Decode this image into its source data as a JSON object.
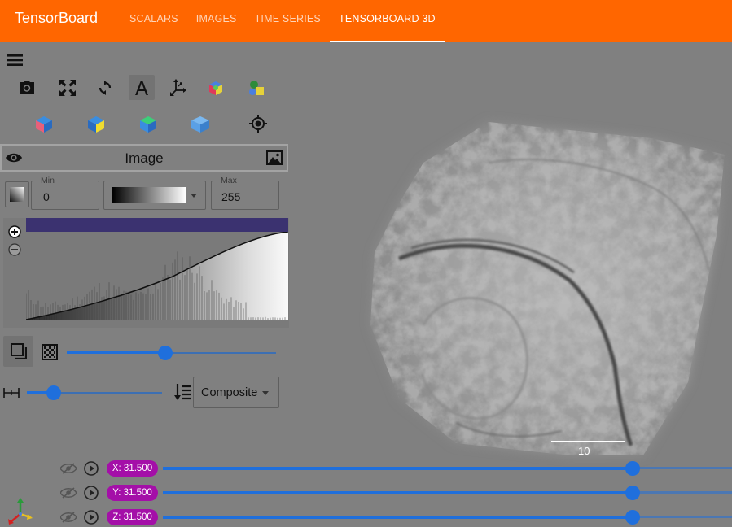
{
  "header": {
    "brand": "TensorBoard",
    "tabs": [
      {
        "label": "SCALARS",
        "active": false
      },
      {
        "label": "IMAGES",
        "active": false
      },
      {
        "label": "TIME SERIES",
        "active": false
      },
      {
        "label": "TENSORBOARD 3D",
        "active": true
      }
    ]
  },
  "toolbar": {
    "icons": [
      "menu-icon",
      "camera-icon",
      "fullscreen-icon",
      "rotate-icon",
      "text-annotation-icon",
      "axes-icon",
      "color-cube-icon",
      "shapes-icon",
      "view-front-icon",
      "view-top-icon",
      "view-side-icon",
      "view-3d-icon",
      "crosshair-icon"
    ]
  },
  "image_panel": {
    "title": "Image",
    "min_label": "Min",
    "min_value": "0",
    "max_label": "Max",
    "max_value": "255",
    "colormap": "grayscale"
  },
  "controls": {
    "opacity_slider_fraction": 0.47,
    "sample_distance_slider_fraction": 0.2,
    "blend_mode": "Composite"
  },
  "viewer": {
    "scale_bar_label": "10"
  },
  "slices": [
    {
      "label": "X: 31.500",
      "fraction": 0.825
    },
    {
      "label": "Y: 31.500",
      "fraction": 0.825
    },
    {
      "label": "Z: 31.500",
      "fraction": 0.825
    }
  ],
  "colors": {
    "header": "#ff6600",
    "accent": "#1f6fdc",
    "slice_pill": "#a40fa8",
    "background": "#808080"
  }
}
